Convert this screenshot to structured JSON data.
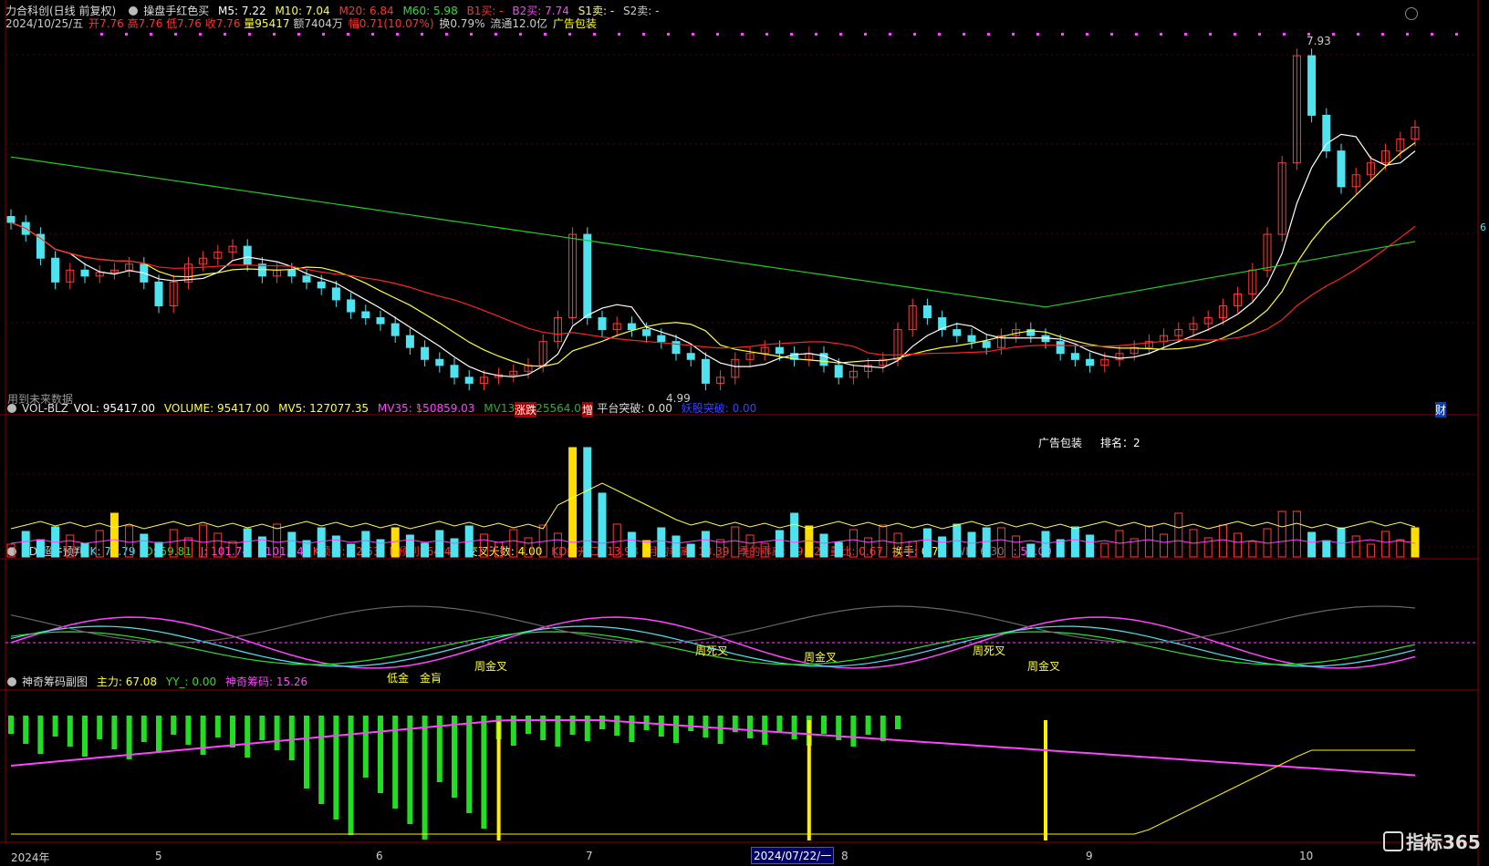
{
  "main_header": {
    "name": "力合科创(日线 前复权)",
    "indicator": "操盘手红色买",
    "ma5": "M5: 7.22",
    "ma10": "M10: 7.04",
    "ma20": "M20: 6.84",
    "ma60": "M60: 5.98",
    "b1": "B1买: -",
    "b2": "B2买: 7.74",
    "s1": "S1卖: -",
    "s2": "S2卖: -",
    "arrow_up": "↑",
    "date": "2024/10/25/五",
    "open": "开7.76",
    "high": "高7.76",
    "low": "低7.76",
    "close": "收7.76",
    "volume": "量95417",
    "amount": "额7404万",
    "change": "幅0.71(10.07%)",
    "turnover": "换0.79%",
    "float": "流通12.0亿",
    "ad": "广告包装"
  },
  "main_chart": {
    "max_label": "7.93",
    "min_label": "4.99",
    "future_data_note": "用到未来数据",
    "tags": [
      {
        "text": "$",
        "color": "#ff3333"
      },
      {
        "text": "涨跌",
        "color": "#ffffff"
      },
      {
        "text": "增",
        "color": "#ffffff"
      },
      {
        "text": "财",
        "color": "#ffffff"
      }
    ],
    "right_tick": "6",
    "colors": {
      "up": "#ff3b3b",
      "down": "#4fe3f0",
      "ma5": "#ffffff",
      "ma10": "#ffff33",
      "ma20": "#ff2222",
      "ma60": "#22cc22"
    }
  },
  "vol_header": {
    "name": "VOL-BLZ",
    "vol": "VOL: 95417.00",
    "volume": "VOLUME: 95417.00",
    "mv5": "MV5: 127077.35",
    "mv35": "MV35: 150859.03",
    "mv135": "MV135: 125564.00",
    "platform": "平台突破: 0.00",
    "stealth": "妖股突破: 0.00"
  },
  "vol_panel": {
    "ad_label": "广告包装",
    "rank_label": "排名：2"
  },
  "kdj_header": {
    "name": "KDJ超牛预判",
    "k": "K: 73.79",
    "d": "D: 59.81",
    "j": "J: 101.74",
    "j2": ": 101.74",
    "kp": "K预判: 82.53",
    "dp": "D预判: 64.47",
    "cross_days": "交叉天数: 4.00",
    "kd_open": "KD的开口: 13.98",
    "month": "月的乖离: 13.39",
    "season": "季的乖离: 29.72",
    "vr": "量比: 0.67",
    "turn": "换手: 0.79",
    "wr": "WR: 6.30",
    "fifty": ": 50.00"
  },
  "kdj_panel": {
    "labels": [
      "低金",
      "金肓",
      "周金叉",
      "周死叉",
      "周金叉",
      "周死叉",
      "周金叉"
    ]
  },
  "chip_header": {
    "name": "神奇筹码副图",
    "main": "主力: 67.08",
    "yy": "YY_: 0.00",
    "chip": "神奇筹码: 15.26"
  },
  "x_axis": [
    "2024年",
    "5",
    "6",
    "7",
    "2024/07/22/一",
    "8",
    "9",
    "10"
  ],
  "watermark": "指标365"
}
